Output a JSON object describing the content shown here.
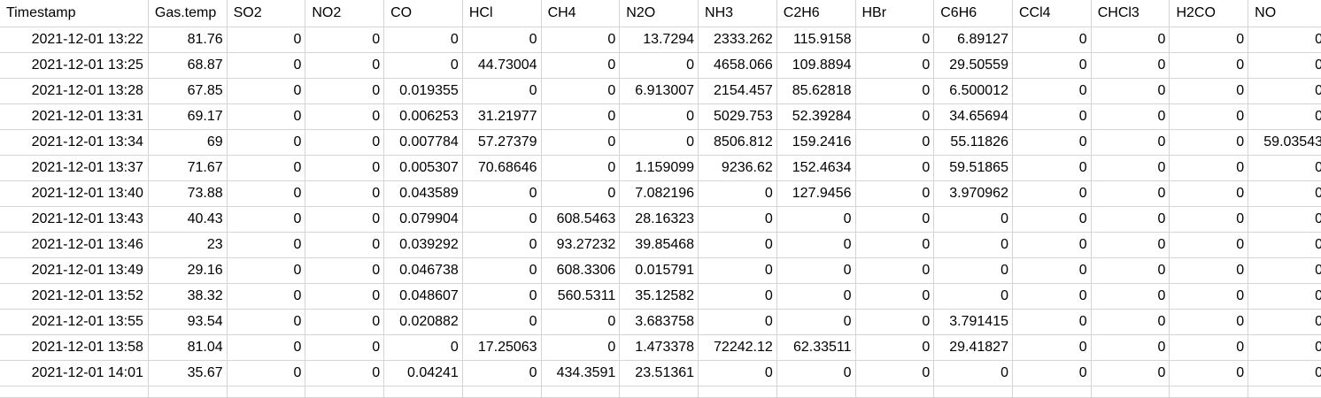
{
  "columns": [
    "Timestamp",
    "Gas.temp",
    "SO2",
    "NO2",
    "CO",
    "HCl",
    "CH4",
    "N2O",
    "NH3",
    "C2H6",
    "HBr",
    "C6H6",
    "CCl4",
    "CHCl3",
    "H2CO",
    "NO"
  ],
  "rows": [
    [
      "2021-12-01 13:22",
      "81.76",
      "0",
      "0",
      "0",
      "0",
      "0",
      "13.7294",
      "2333.262",
      "115.9158",
      "0",
      "6.89127",
      "0",
      "0",
      "0",
      "0"
    ],
    [
      "2021-12-01 13:25",
      "68.87",
      "0",
      "0",
      "0",
      "44.73004",
      "0",
      "0",
      "4658.066",
      "109.8894",
      "0",
      "29.50559",
      "0",
      "0",
      "0",
      "0"
    ],
    [
      "2021-12-01 13:28",
      "67.85",
      "0",
      "0",
      "0.019355",
      "0",
      "0",
      "6.913007",
      "2154.457",
      "85.62818",
      "0",
      "6.500012",
      "0",
      "0",
      "0",
      "0"
    ],
    [
      "2021-12-01 13:31",
      "69.17",
      "0",
      "0",
      "0.006253",
      "31.21977",
      "0",
      "0",
      "5029.753",
      "52.39284",
      "0",
      "34.65694",
      "0",
      "0",
      "0",
      "0"
    ],
    [
      "2021-12-01 13:34",
      "69",
      "0",
      "0",
      "0.007784",
      "57.27379",
      "0",
      "0",
      "8506.812",
      "159.2416",
      "0",
      "55.11826",
      "0",
      "0",
      "0",
      "59.03543"
    ],
    [
      "2021-12-01 13:37",
      "71.67",
      "0",
      "0",
      "0.005307",
      "70.68646",
      "0",
      "1.159099",
      "9236.62",
      "152.4634",
      "0",
      "59.51865",
      "0",
      "0",
      "0",
      "0"
    ],
    [
      "2021-12-01 13:40",
      "73.88",
      "0",
      "0",
      "0.043589",
      "0",
      "0",
      "7.082196",
      "0",
      "127.9456",
      "0",
      "3.970962",
      "0",
      "0",
      "0",
      "0"
    ],
    [
      "2021-12-01 13:43",
      "40.43",
      "0",
      "0",
      "0.079904",
      "0",
      "608.5463",
      "28.16323",
      "0",
      "0",
      "0",
      "0",
      "0",
      "0",
      "0",
      "0"
    ],
    [
      "2021-12-01 13:46",
      "23",
      "0",
      "0",
      "0.039292",
      "0",
      "93.27232",
      "39.85468",
      "0",
      "0",
      "0",
      "0",
      "0",
      "0",
      "0",
      "0"
    ],
    [
      "2021-12-01 13:49",
      "29.16",
      "0",
      "0",
      "0.046738",
      "0",
      "608.3306",
      "0.015791",
      "0",
      "0",
      "0",
      "0",
      "0",
      "0",
      "0",
      "0"
    ],
    [
      "2021-12-01 13:52",
      "38.32",
      "0",
      "0",
      "0.048607",
      "0",
      "560.5311",
      "35.12582",
      "0",
      "0",
      "0",
      "0",
      "0",
      "0",
      "0",
      "0"
    ],
    [
      "2021-12-01 13:55",
      "93.54",
      "0",
      "0",
      "0.020882",
      "0",
      "0",
      "3.683758",
      "0",
      "0",
      "0",
      "3.791415",
      "0",
      "0",
      "0",
      "0"
    ],
    [
      "2021-12-01 13:58",
      "81.04",
      "0",
      "0",
      "0",
      "17.25063",
      "0",
      "1.473378",
      "72242.12",
      "62.33511",
      "0",
      "29.41827",
      "0",
      "0",
      "0",
      "0"
    ],
    [
      "2021-12-01 14:01",
      "35.67",
      "0",
      "0",
      "0.04241",
      "0",
      "434.3591",
      "23.51361",
      "0",
      "0",
      "0",
      "0",
      "0",
      "0",
      "0",
      "0"
    ]
  ]
}
